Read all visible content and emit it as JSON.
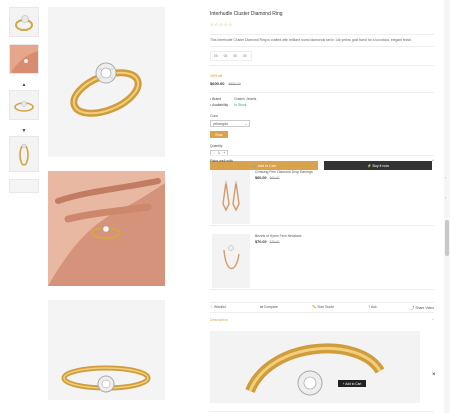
{
  "thumbnails": {
    "nav_up": "▲",
    "nav_down": "▼"
  },
  "product": {
    "title": "Interhudle Cluster Diamond Ring",
    "stars": "☆☆☆☆☆",
    "description": "This Interhudle Cluster Diamond Ring is crafted with brilliant round diamonds set in 14k yellow gold band for a luxurious, elegant finish.",
    "countdown": [
      "00",
      "00",
      "00",
      "00"
    ],
    "offer_text": "10% off",
    "price": "$600.00",
    "old_price": "$650.00",
    "meta": [
      {
        "key": "Brand",
        "value": "Golden Jewels"
      },
      {
        "key": "Availability",
        "value": "In Stock"
      }
    ],
    "option_label": "Color",
    "option_selected": "yellowgold",
    "option_button": "Rose",
    "qty_label": "Quantity",
    "qty": [
      "-",
      "1",
      "+"
    ],
    "add_to_cart": "Add to Cart",
    "buy_now": "Buy it now"
  },
  "pair_section": {
    "title": "Pairs well with",
    "toggle": "^",
    "items": [
      {
        "name": "Crossing Fern Diamond Drop Earrings",
        "price": "$60.00",
        "old_price": "$65.00"
      },
      {
        "name": "Bezels of Hymn Fern Necklace",
        "price": "$70.00",
        "old_price": "$75.00"
      }
    ]
  },
  "actions": [
    "Wishlist",
    "Compare",
    "Size Guide",
    "Ask",
    "Share Video"
  ],
  "description_tab": {
    "label": "Description",
    "toggle": "^"
  },
  "sticky": {
    "add_to_cart": "+ Add to Cart",
    "close": "×"
  },
  "colors": {
    "gold": "#d9a24d",
    "dark": "#333333",
    "instock": "#3aa35a"
  }
}
